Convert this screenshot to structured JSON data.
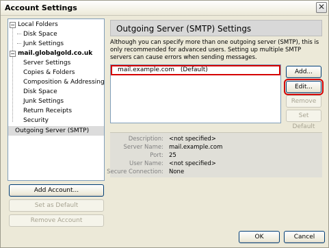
{
  "window": {
    "title": "Account Settings"
  },
  "tree": {
    "local_folders": {
      "label": "Local Folders",
      "expander": "−"
    },
    "local_children": [
      "Disk Space",
      "Junk Settings"
    ],
    "account": {
      "label": "mail.globalgold.co.uk",
      "expander": "−"
    },
    "account_children": [
      "Server Settings",
      "Copies & Folders",
      "Composition & Addressing",
      "Disk Space",
      "Junk Settings",
      "Return Receipts",
      "Security"
    ],
    "outgoing": {
      "label": "Outgoing Server (SMTP)"
    }
  },
  "left_buttons": {
    "add_account": "Add Account...",
    "set_default": "Set as Default",
    "remove_account": "Remove Account"
  },
  "panel": {
    "title": "Outgoing Server (SMTP) Settings",
    "description": "Although you can specify more than one outgoing server (SMTP), this is only recommended for advanced users. Setting up multiple SMTP servers can cause errors when sending messages."
  },
  "server_list": [
    {
      "name": "mail.example.com",
      "tag": "(Default)"
    }
  ],
  "right_buttons": {
    "add": "Add...",
    "edit": "Edit...",
    "remove": "Remove",
    "set_default": "Set Default"
  },
  "details": {
    "rows": [
      {
        "label": "Description:",
        "value": "<not specified>"
      },
      {
        "label": "Server Name:",
        "value": "mail.example.com"
      },
      {
        "label": "Port:",
        "value": "25"
      },
      {
        "label": "User Name:",
        "value": "<not specified>"
      },
      {
        "label": "Secure Connection:",
        "value": "None"
      }
    ]
  },
  "footer": {
    "ok": "OK",
    "cancel": "Cancel"
  },
  "icons": {
    "close": "close-icon"
  }
}
